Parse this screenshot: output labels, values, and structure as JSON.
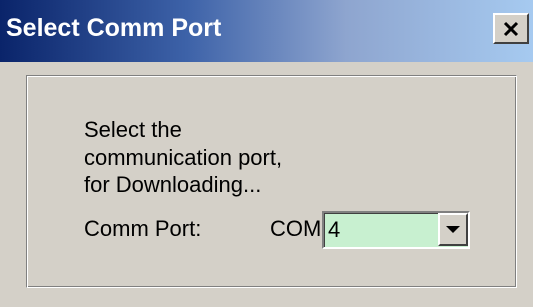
{
  "window": {
    "title": "Select Comm Port",
    "close_icon": "close-icon"
  },
  "content": {
    "instruction_line1": "Select the",
    "instruction_line2": "communication port,",
    "instruction_line3": "for Downloading...",
    "port_label": "Comm Port:",
    "com_prefix": "COM",
    "port_value": "4",
    "dropdown_icon": "chevron-down-icon"
  },
  "colors": {
    "titlebar_start": "#0a246a",
    "titlebar_end": "#a6caf0",
    "dialog_bg": "#d4d0c8",
    "combo_bg": "#c8f0d0"
  }
}
